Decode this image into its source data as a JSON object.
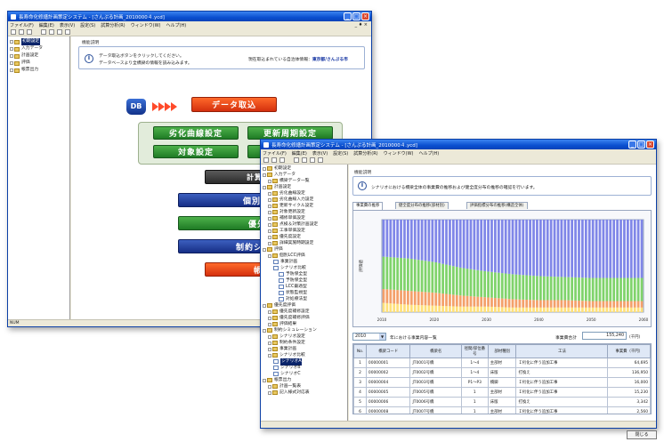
{
  "back_window": {
    "title": "長寿命化修繕計画策定システム - [さんぷる計画_2010000４.ycd]",
    "menu": [
      "ファイル(F)",
      "編集(E)",
      "表示(V)",
      "設定(S)",
      "試算分析(R)",
      "ウィンドウ(W)",
      "ヘルプ(H)"
    ],
    "tree": [
      {
        "label": "初期設定",
        "level": 0,
        "selected": true
      },
      {
        "label": "入力データ",
        "level": 0
      },
      {
        "label": "計画設定",
        "level": 0
      },
      {
        "label": "評価",
        "level": 0
      },
      {
        "label": "帳票出力",
        "level": 0
      }
    ],
    "guide_label": "機能説明",
    "guide_line1": "データ取込ボタンをクリックしてください。",
    "guide_line2": "データベースより全橋梁の情報を読み込みます。",
    "target_label": "現在取込まれている自治体情報：",
    "target_value": "東京都/さんぷる市",
    "db_label": "DB",
    "buttons": {
      "data_import": "データ取込",
      "deterioration": "劣化曲線設定",
      "renewal": "更新周期設定",
      "target": "対象設定",
      "calc_target": "計算対象",
      "individual": "個別構築",
      "priority": "優先度",
      "constrained_sim": "制約シミュ",
      "report": "帳票"
    },
    "status": "NUM"
  },
  "front_window": {
    "title": "長寿命化修繕計画策定システム - [さんぷる計画_2010000４.ycd]",
    "menu": [
      "ファイル(F)",
      "編集(E)",
      "表示(V)",
      "設定(S)",
      "試算分析(R)",
      "ウィンドウ(W)",
      "ヘルプ(H)"
    ],
    "tree": [
      {
        "label": "初期設定",
        "level": 0
      },
      {
        "label": "入力データ",
        "level": 0
      },
      {
        "label": "橋梁データ一覧",
        "level": 1
      },
      {
        "label": "計画設定",
        "level": 0
      },
      {
        "label": "劣化曲線設定",
        "level": 1
      },
      {
        "label": "劣化曲線入力設定",
        "level": 1
      },
      {
        "label": "更新サイクル設定",
        "level": 1
      },
      {
        "label": "対象更新設定",
        "level": 1
      },
      {
        "label": "補修単価設定",
        "level": 1
      },
      {
        "label": "点検＆対策計画設定",
        "level": 1
      },
      {
        "label": "工事単価設定",
        "level": 1
      },
      {
        "label": "優先度設定",
        "level": 1
      },
      {
        "label": "詳細実施時期設定",
        "level": 1
      },
      {
        "label": "評価",
        "level": 0
      },
      {
        "label": "個別LCC評価",
        "level": 1
      },
      {
        "label": "事業計画",
        "level": 2
      },
      {
        "label": "シナリオ比較",
        "level": 2
      },
      {
        "label": "予防保全型",
        "level": 3
      },
      {
        "label": "予防保全型",
        "level": 3
      },
      {
        "label": "LCC最適型",
        "level": 3
      },
      {
        "label": "状態監視型",
        "level": 3
      },
      {
        "label": "対処療法型",
        "level": 3
      },
      {
        "label": "優先度評価",
        "level": 0
      },
      {
        "label": "優先度補修設定",
        "level": 1
      },
      {
        "label": "優先度補修評価",
        "level": 1
      },
      {
        "label": "評価結果",
        "level": 1
      },
      {
        "label": "制約シミュレーション",
        "level": 0
      },
      {
        "label": "シナリオ設定",
        "level": 1
      },
      {
        "label": "制約条件設定",
        "level": 1
      },
      {
        "label": "事業計画",
        "level": 1
      },
      {
        "label": "シナリオ比較",
        "level": 1
      },
      {
        "label": "シナリオA",
        "level": 2,
        "selected": true
      },
      {
        "label": "シナリオB",
        "level": 2
      },
      {
        "label": "シナリオC",
        "level": 2
      },
      {
        "label": "帳票出力",
        "level": 0
      },
      {
        "label": "計画一覧表",
        "level": 1
      },
      {
        "label": "記入様式対応表",
        "level": 1
      }
    ],
    "guide_label": "機能説明",
    "guide_line": "シナリオにおける橋梁全体の事業費の推移および健全度分布の推移の確認を行います。",
    "tabs": [
      "事業費の推移",
      "健全度分布の推移(部材別)",
      "評価指標分布の推移(構造全体)"
    ],
    "chart_ylabel": "評価値",
    "year_select": "2010",
    "year_suffix": "年における事業内容一覧",
    "total_label": "事業費合計",
    "total_value": "155,240",
    "total_unit": "(千円)",
    "table_headers": [
      "No.",
      "橋梁コード",
      "橋梁名",
      "径間/部位番号",
      "部材種別",
      "工法",
      "事業費（千円）"
    ],
    "rows": [
      [
        "1",
        "00000001",
        "JT0001号橋",
        "1〜4",
        "主部材",
        "Ｉ桁化に伴う追加工事",
        "64,695"
      ],
      [
        "2",
        "00000002",
        "JT0002号橋",
        "1〜4",
        "床版",
        "打換え",
        "136,950"
      ],
      [
        "3",
        "00000004",
        "JT0003号橋",
        "P1〜P3",
        "橋脚",
        "Ｉ桁化に伴う追加工事",
        "16,000"
      ],
      [
        "4",
        "00000005",
        "JT0005号橋",
        "1",
        "主部材",
        "Ｉ桁化に伴う追加工事",
        "15,230"
      ],
      [
        "5",
        "00000006",
        "JT0006号橋",
        "1",
        "床版",
        "打換え",
        "3,342"
      ],
      [
        "6",
        "00000008",
        "JT0007号橋",
        "1",
        "主部材",
        "Ｉ桁化に伴う追加工事",
        "2,560"
      ]
    ],
    "close_button": "閉じる"
  },
  "chart_data": {
    "type": "area",
    "x": [
      "2010",
      "2015",
      "2020",
      "2025",
      "2030",
      "2035",
      "2040",
      "2045",
      "2050",
      "2055",
      "2060"
    ],
    "xlabel": "",
    "ylabel": "評価値",
    "series": [
      {
        "name": "",
        "color": "#ffe07a",
        "values": [
          10,
          8,
          7,
          6,
          6,
          5,
          5,
          5,
          5,
          5,
          5
        ]
      },
      {
        "name": "",
        "color": "#f4a06a",
        "values": [
          15,
          15,
          14,
          12,
          10,
          9,
          8,
          8,
          7,
          7,
          7
        ]
      },
      {
        "name": "",
        "color": "#7fd36b",
        "values": [
          35,
          35,
          33,
          30,
          28,
          27,
          26,
          25,
          25,
          25,
          25
        ]
      },
      {
        "name": "",
        "color": "#7f86e8",
        "values": [
          40,
          42,
          46,
          52,
          56,
          59,
          61,
          62,
          63,
          63,
          63
        ]
      }
    ],
    "ylim": [
      0,
      100
    ],
    "grid": false
  },
  "colors": {
    "accent": "#0a4fd0",
    "green_button": "#2f8f33",
    "blue_button": "#1e3a9a",
    "red_button": "#e8441a",
    "flow_panel": "#e2ecdb"
  }
}
